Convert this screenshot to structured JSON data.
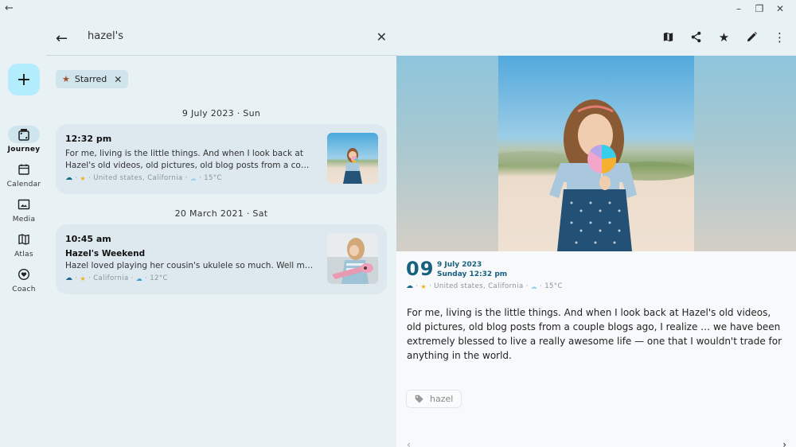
{
  "window": {
    "back_icon": "←",
    "minimize_icon": "–",
    "restore_icon": "❐",
    "close_icon": "✕"
  },
  "rail": {
    "new_entry_icon": "+",
    "items": [
      {
        "label": "Journey",
        "icon": "journey-icon",
        "active": true
      },
      {
        "label": "Calendar",
        "icon": "calendar-icon",
        "active": false
      },
      {
        "label": "Media",
        "icon": "media-icon",
        "active": false
      },
      {
        "label": "Atlas",
        "icon": "map-icon",
        "active": false
      },
      {
        "label": "Coach",
        "icon": "heart-icon",
        "active": false
      }
    ]
  },
  "search": {
    "back_icon": "←",
    "query": "hazel's",
    "clear_icon": "✕",
    "filter_chip": {
      "label": "Starred",
      "icon": "★",
      "remove_icon": "✕"
    }
  },
  "results": [
    {
      "date_heading": "9 July 2023 · Sun",
      "time": "12:32 pm",
      "title": "",
      "text": "For me, living is the little things. And when I look back at Hazel's old videos, old pictures, old blog posts from a co…",
      "meta": {
        "cloud": "☁",
        "star": "★",
        "location": "United states, California",
        "weather_icon": "☁",
        "temperature": "15°C"
      }
    },
    {
      "date_heading": "20 March 2021 · Sat",
      "time": "10:45 am",
      "title": "Hazel's Weekend",
      "text": "Hazel loved playing her cousin's ukulele so much. Well m…",
      "meta": {
        "cloud": "☁",
        "star": "★",
        "location": "California",
        "weather_icon": "☁",
        "temperature": "12°C"
      }
    }
  ],
  "detail": {
    "toolbar": {
      "map_icon": "map-icon",
      "share_icon": "share-icon",
      "star_icon": "★",
      "edit_icon": "✎",
      "more_icon": "⋮"
    },
    "day_number": "09",
    "date_line": "9 July 2023",
    "day_time_line": "Sunday 12:32 pm",
    "meta": {
      "cloud": "☁",
      "star": "★",
      "location": "United states, California",
      "weather_icon": "☁",
      "temperature": "15°C"
    },
    "body": "For me, living is the little things. And when I look back at Hazel's old videos, old pictures, old blog posts from a couple blogs ago, I realize … we have been extremely blessed to live a really awesome life — one that I wouldn't trade for anything in the world.",
    "tag": "hazel",
    "prev_icon": "‹",
    "next_icon": "›"
  },
  "colors": {
    "accent": "#17607e",
    "fab": "#b3ecfd",
    "star": "#f2b01e"
  }
}
